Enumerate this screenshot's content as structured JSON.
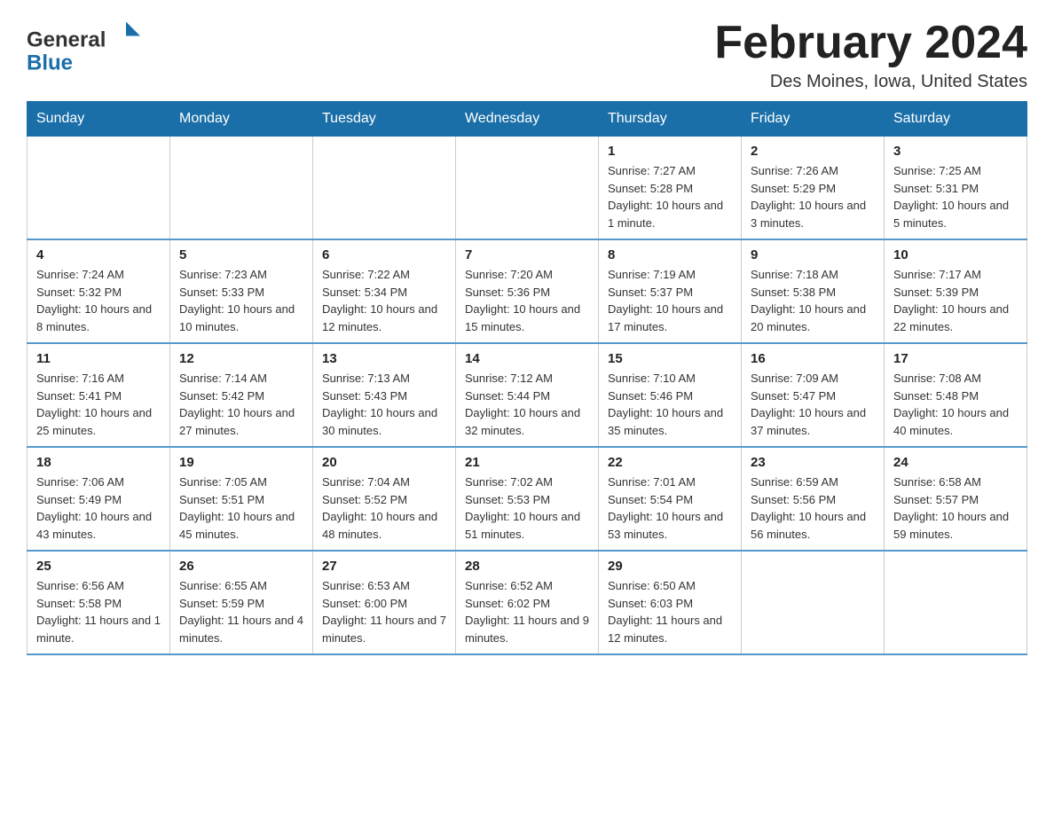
{
  "header": {
    "logo_general": "General",
    "logo_blue": "Blue",
    "month_title": "February 2024",
    "location": "Des Moines, Iowa, United States"
  },
  "days_of_week": [
    "Sunday",
    "Monday",
    "Tuesday",
    "Wednesday",
    "Thursday",
    "Friday",
    "Saturday"
  ],
  "weeks": [
    {
      "cells": [
        {
          "day": "",
          "info": ""
        },
        {
          "day": "",
          "info": ""
        },
        {
          "day": "",
          "info": ""
        },
        {
          "day": "",
          "info": ""
        },
        {
          "day": "1",
          "info": "Sunrise: 7:27 AM\nSunset: 5:28 PM\nDaylight: 10 hours and 1 minute."
        },
        {
          "day": "2",
          "info": "Sunrise: 7:26 AM\nSunset: 5:29 PM\nDaylight: 10 hours and 3 minutes."
        },
        {
          "day": "3",
          "info": "Sunrise: 7:25 AM\nSunset: 5:31 PM\nDaylight: 10 hours and 5 minutes."
        }
      ]
    },
    {
      "cells": [
        {
          "day": "4",
          "info": "Sunrise: 7:24 AM\nSunset: 5:32 PM\nDaylight: 10 hours and 8 minutes."
        },
        {
          "day": "5",
          "info": "Sunrise: 7:23 AM\nSunset: 5:33 PM\nDaylight: 10 hours and 10 minutes."
        },
        {
          "day": "6",
          "info": "Sunrise: 7:22 AM\nSunset: 5:34 PM\nDaylight: 10 hours and 12 minutes."
        },
        {
          "day": "7",
          "info": "Sunrise: 7:20 AM\nSunset: 5:36 PM\nDaylight: 10 hours and 15 minutes."
        },
        {
          "day": "8",
          "info": "Sunrise: 7:19 AM\nSunset: 5:37 PM\nDaylight: 10 hours and 17 minutes."
        },
        {
          "day": "9",
          "info": "Sunrise: 7:18 AM\nSunset: 5:38 PM\nDaylight: 10 hours and 20 minutes."
        },
        {
          "day": "10",
          "info": "Sunrise: 7:17 AM\nSunset: 5:39 PM\nDaylight: 10 hours and 22 minutes."
        }
      ]
    },
    {
      "cells": [
        {
          "day": "11",
          "info": "Sunrise: 7:16 AM\nSunset: 5:41 PM\nDaylight: 10 hours and 25 minutes."
        },
        {
          "day": "12",
          "info": "Sunrise: 7:14 AM\nSunset: 5:42 PM\nDaylight: 10 hours and 27 minutes."
        },
        {
          "day": "13",
          "info": "Sunrise: 7:13 AM\nSunset: 5:43 PM\nDaylight: 10 hours and 30 minutes."
        },
        {
          "day": "14",
          "info": "Sunrise: 7:12 AM\nSunset: 5:44 PM\nDaylight: 10 hours and 32 minutes."
        },
        {
          "day": "15",
          "info": "Sunrise: 7:10 AM\nSunset: 5:46 PM\nDaylight: 10 hours and 35 minutes."
        },
        {
          "day": "16",
          "info": "Sunrise: 7:09 AM\nSunset: 5:47 PM\nDaylight: 10 hours and 37 minutes."
        },
        {
          "day": "17",
          "info": "Sunrise: 7:08 AM\nSunset: 5:48 PM\nDaylight: 10 hours and 40 minutes."
        }
      ]
    },
    {
      "cells": [
        {
          "day": "18",
          "info": "Sunrise: 7:06 AM\nSunset: 5:49 PM\nDaylight: 10 hours and 43 minutes."
        },
        {
          "day": "19",
          "info": "Sunrise: 7:05 AM\nSunset: 5:51 PM\nDaylight: 10 hours and 45 minutes."
        },
        {
          "day": "20",
          "info": "Sunrise: 7:04 AM\nSunset: 5:52 PM\nDaylight: 10 hours and 48 minutes."
        },
        {
          "day": "21",
          "info": "Sunrise: 7:02 AM\nSunset: 5:53 PM\nDaylight: 10 hours and 51 minutes."
        },
        {
          "day": "22",
          "info": "Sunrise: 7:01 AM\nSunset: 5:54 PM\nDaylight: 10 hours and 53 minutes."
        },
        {
          "day": "23",
          "info": "Sunrise: 6:59 AM\nSunset: 5:56 PM\nDaylight: 10 hours and 56 minutes."
        },
        {
          "day": "24",
          "info": "Sunrise: 6:58 AM\nSunset: 5:57 PM\nDaylight: 10 hours and 59 minutes."
        }
      ]
    },
    {
      "cells": [
        {
          "day": "25",
          "info": "Sunrise: 6:56 AM\nSunset: 5:58 PM\nDaylight: 11 hours and 1 minute."
        },
        {
          "day": "26",
          "info": "Sunrise: 6:55 AM\nSunset: 5:59 PM\nDaylight: 11 hours and 4 minutes."
        },
        {
          "day": "27",
          "info": "Sunrise: 6:53 AM\nSunset: 6:00 PM\nDaylight: 11 hours and 7 minutes."
        },
        {
          "day": "28",
          "info": "Sunrise: 6:52 AM\nSunset: 6:02 PM\nDaylight: 11 hours and 9 minutes."
        },
        {
          "day": "29",
          "info": "Sunrise: 6:50 AM\nSunset: 6:03 PM\nDaylight: 11 hours and 12 minutes."
        },
        {
          "day": "",
          "info": ""
        },
        {
          "day": "",
          "info": ""
        }
      ]
    }
  ]
}
